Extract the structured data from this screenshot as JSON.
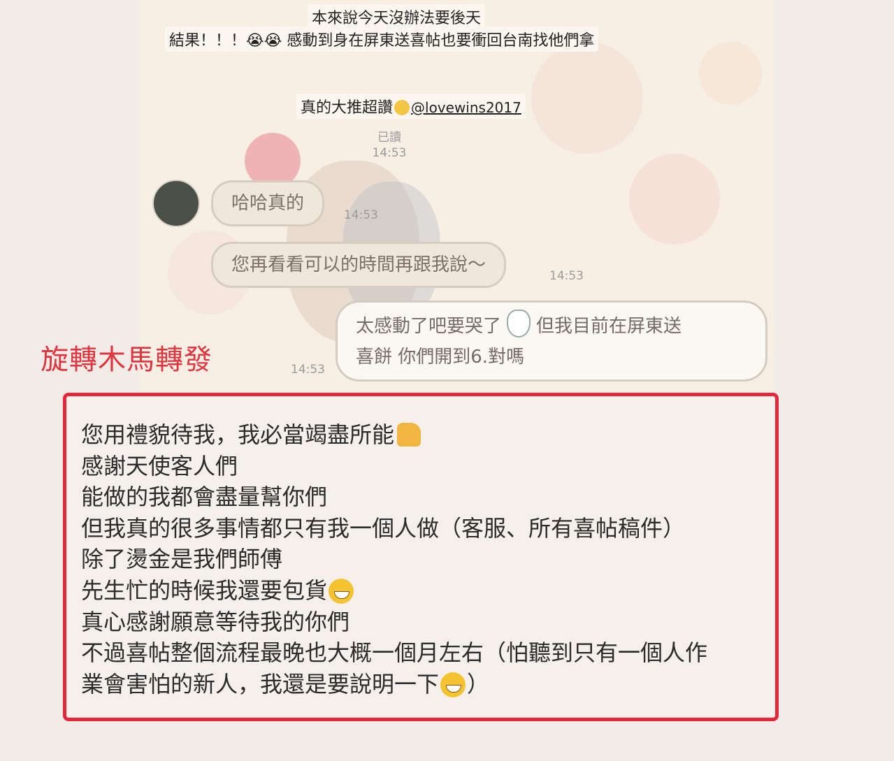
{
  "screenshot": {
    "caption": {
      "line1": "本來說今天沒辦法要後天",
      "line2": "結果！！！😭😭 感動到身在屏東送喜帖也要衝回台南找他們拿",
      "line3_text": "真的大推超讚",
      "line3_mention": "@lovewins2017"
    },
    "read_status": "已讀",
    "read_time": "14:53",
    "incoming": [
      {
        "text": "哈哈真的",
        "time": "14:53"
      },
      {
        "text": "您再看看可以的時間再跟我說～",
        "time": "14:53"
      }
    ],
    "outgoing": {
      "line1_a": "太感動了吧要哭了",
      "line1_b": "但我目前在屏東送",
      "line2": "喜餅 你們開到6.對嗎",
      "time": "14:53"
    }
  },
  "repost_label": "旋轉木馬轉發",
  "message": {
    "lines": [
      "您用禮貌待我，我必當竭盡所能",
      "感謝天使客人們",
      "能做的我都會盡量幫你們",
      "但我真的很多事情都只有我一個人做（客服、所有喜帖稿件）",
      "除了燙金是我們師傅",
      "先生忙的時候我還要包貨",
      "真心感謝願意等待我的你們",
      "不過喜帖整個流程最晚也大概一個月左右（怕聽到只有一個人作",
      "業會害怕的新人，我還是要說明一下"
    ],
    "last_suffix": "）"
  },
  "icons": {
    "thumbs_up": "thumbs-up-icon",
    "grin": "grinning-face-icon",
    "crying": "crying-face-icon",
    "bunny": "bunny-sticker-icon"
  },
  "colors": {
    "highlight_border": "#e8263b",
    "repost_label": "#e0353f"
  }
}
